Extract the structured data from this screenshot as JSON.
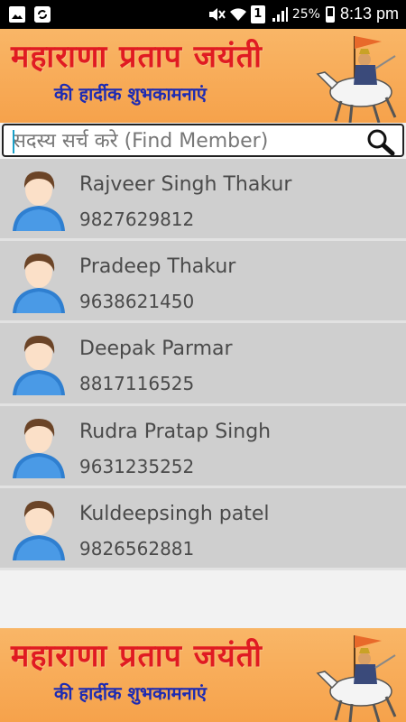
{
  "status_bar": {
    "battery": "25%",
    "time": "8:13 pm",
    "sim_slot": "1"
  },
  "banner": {
    "title": "महाराणा प्रताप जयंती",
    "subtitle": "की हार्दीक शुभकामनाएं"
  },
  "search": {
    "placeholder": "सदस्य सर्च करे (Find Member)"
  },
  "members": [
    {
      "name": "Rajveer Singh Thakur",
      "phone": "9827629812"
    },
    {
      "name": "Pradeep Thakur",
      "phone": "9638621450"
    },
    {
      "name": "Deepak Parmar",
      "phone": "8817116525"
    },
    {
      "name": "Rudra Pratap Singh",
      "phone": "9631235252"
    },
    {
      "name": "Kuldeepsingh patel",
      "phone": "9826562881"
    }
  ],
  "colors": {
    "banner_bg": "#f6a24b",
    "banner_title": "#e01b22",
    "banner_subtitle": "#1d2bb3",
    "list_bg": "#cfcfcf"
  }
}
